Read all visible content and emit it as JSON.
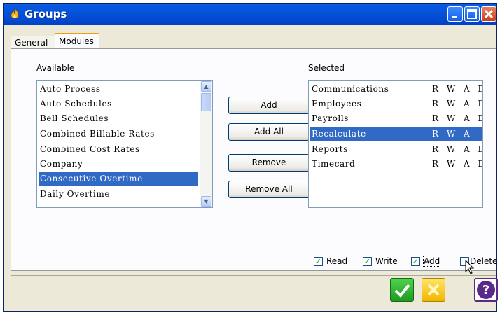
{
  "window": {
    "title": "Groups"
  },
  "tabs": [
    {
      "label": "General"
    },
    {
      "label": "Modules"
    }
  ],
  "available": {
    "label": "Available",
    "items": [
      {
        "label": "Auto Process"
      },
      {
        "label": "Auto Schedules"
      },
      {
        "label": "Bell Schedules"
      },
      {
        "label": "Combined Billable Rates"
      },
      {
        "label": "Combined Cost Rates"
      },
      {
        "label": "Company"
      },
      {
        "label": "Consecutive Overtime",
        "selected": true
      },
      {
        "label": "Daily Overtime"
      }
    ]
  },
  "selected": {
    "label": "Selected",
    "items": [
      {
        "label": "Communications",
        "perms": "R W A D"
      },
      {
        "label": "Employees",
        "perms": "R W A D"
      },
      {
        "label": "Payrolls",
        "perms": "R W A D"
      },
      {
        "label": "Recalculate",
        "perms": "R W A",
        "selected": true
      },
      {
        "label": "Reports",
        "perms": "R W A D"
      },
      {
        "label": "Timecard",
        "perms": "R W A D"
      }
    ]
  },
  "buttons": {
    "add": "Add",
    "add_all": "Add All",
    "remove": "Remove",
    "remove_all": "Remove All"
  },
  "permissions": [
    {
      "label": "Read",
      "checked": true
    },
    {
      "label": "Write",
      "checked": true
    },
    {
      "label": "Add",
      "checked": true
    },
    {
      "label": "Delete",
      "checked": false
    }
  ],
  "colors": {
    "selection": "#316ac5",
    "titlebar": "#0453d9",
    "ok": "#1f9a1f",
    "cancel": "#f2b600",
    "help": "#5a2a8a"
  }
}
